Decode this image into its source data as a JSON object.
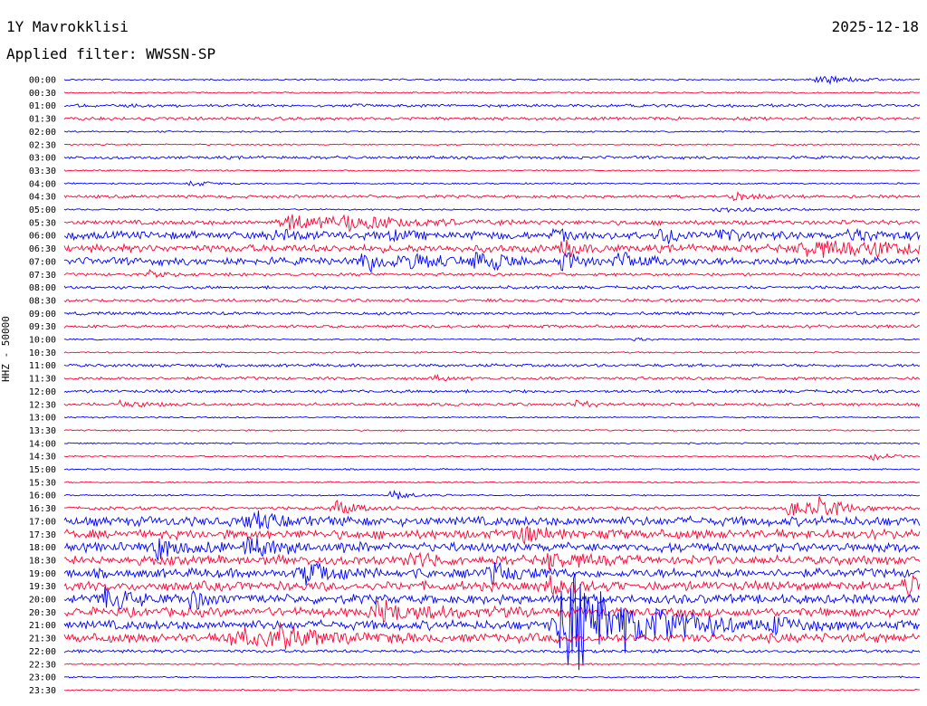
{
  "header": {
    "station": "1Y Mavrokklisi",
    "filter": "Applied filter: WWSSN-SP",
    "date": "2025-12-18"
  },
  "channel_label": "HHZ - 50000",
  "chart_data": {
    "type": "line",
    "title": "1Y Mavrokklisi",
    "subtitle": "Applied filter: WWSSN-SP",
    "ylabel": "HHZ - 50000",
    "grid": false,
    "colors": {
      "blue": "#0000ff",
      "red": "#ff0033"
    },
    "rows": [
      "00:00",
      "00:30",
      "01:00",
      "01:30",
      "02:00",
      "02:30",
      "03:00",
      "03:30",
      "04:00",
      "04:30",
      "05:00",
      "05:30",
      "06:00",
      "06:30",
      "07:00",
      "07:30",
      "08:00",
      "08:30",
      "09:00",
      "09:30",
      "10:00",
      "10:30",
      "11:00",
      "11:30",
      "12:00",
      "12:30",
      "13:00",
      "13:30",
      "14:00",
      "14:30",
      "15:00",
      "15:30",
      "16:00",
      "16:30",
      "17:00",
      "17:30",
      "18:00",
      "18:30",
      "19:00",
      "19:30",
      "20:00",
      "20:30",
      "21:00",
      "21:30",
      "22:00",
      "22:30",
      "23:00",
      "23:30"
    ],
    "noise_level": [
      1,
      1,
      2,
      2,
      1,
      1,
      2,
      1,
      1,
      2,
      1,
      3,
      5,
      5,
      5,
      2,
      2,
      2,
      2,
      2,
      1,
      1,
      2,
      2,
      2,
      2,
      1,
      1,
      1,
      1,
      1,
      1,
      1,
      2,
      6,
      6,
      6,
      6,
      6,
      6,
      6,
      6,
      6,
      6,
      2,
      1,
      1,
      1
    ],
    "events": [
      {
        "row": "00:00",
        "minute": 26.5,
        "amp": 6,
        "dur": 1.5
      },
      {
        "row": "04:00",
        "minute": 4.5,
        "amp": 3,
        "dur": 1.0
      },
      {
        "row": "04:30",
        "minute": 23.5,
        "amp": 4,
        "dur": 1.2
      },
      {
        "row": "05:00",
        "minute": 23.0,
        "amp": 3,
        "dur": 2.0
      },
      {
        "row": "05:30",
        "minute": 8.0,
        "amp": 10,
        "dur": 2.5
      },
      {
        "row": "05:30",
        "minute": 10.0,
        "amp": 7,
        "dur": 2.5
      },
      {
        "row": "06:00",
        "minute": 7.5,
        "amp": 8,
        "dur": 1.0
      },
      {
        "row": "06:00",
        "minute": 11.5,
        "amp": 7,
        "dur": 0.5
      },
      {
        "row": "06:00",
        "minute": 17.2,
        "amp": 7,
        "dur": 0.5
      },
      {
        "row": "06:00",
        "minute": 21.0,
        "amp": 10,
        "dur": 0.8
      },
      {
        "row": "06:00",
        "minute": 23.0,
        "amp": 9,
        "dur": 0.8
      },
      {
        "row": "06:00",
        "minute": 27.6,
        "amp": 8,
        "dur": 1.0
      },
      {
        "row": "06:30",
        "minute": 17.5,
        "amp": 9,
        "dur": 0.8
      },
      {
        "row": "06:30",
        "minute": 26.0,
        "amp": 9,
        "dur": 2.5
      },
      {
        "row": "06:30",
        "minute": 28.5,
        "amp": 8,
        "dur": 1.2
      },
      {
        "row": "07:00",
        "minute": 10.5,
        "amp": 12,
        "dur": 1.2
      },
      {
        "row": "07:00",
        "minute": 12.3,
        "amp": 10,
        "dur": 1.0
      },
      {
        "row": "07:00",
        "minute": 14.5,
        "amp": 12,
        "dur": 1.2
      },
      {
        "row": "07:00",
        "minute": 17.5,
        "amp": 10,
        "dur": 1.0
      },
      {
        "row": "07:00",
        "minute": 19.5,
        "amp": 10,
        "dur": 1.0
      },
      {
        "row": "07:30",
        "minute": 3.0,
        "amp": 4,
        "dur": 1.0
      },
      {
        "row": "10:00",
        "minute": 20.0,
        "amp": 3,
        "dur": 0.5
      },
      {
        "row": "11:30",
        "minute": 13.0,
        "amp": 3,
        "dur": 0.6
      },
      {
        "row": "12:30",
        "minute": 2.0,
        "amp": 6,
        "dur": 0.8
      },
      {
        "row": "12:30",
        "minute": 18.0,
        "amp": 6,
        "dur": 0.6
      },
      {
        "row": "14:30",
        "minute": 28.3,
        "amp": 4,
        "dur": 1.0
      },
      {
        "row": "16:00",
        "minute": 11.5,
        "amp": 7,
        "dur": 0.8
      },
      {
        "row": "16:30",
        "minute": 9.5,
        "amp": 12,
        "dur": 0.8
      },
      {
        "row": "16:30",
        "minute": 25.5,
        "amp": 11,
        "dur": 1.2
      },
      {
        "row": "16:30",
        "minute": 26.5,
        "amp": 10,
        "dur": 1.2
      },
      {
        "row": "17:00",
        "minute": 6.5,
        "amp": 9,
        "dur": 1.2
      },
      {
        "row": "17:30",
        "minute": 16.0,
        "amp": 12,
        "dur": 1.0
      },
      {
        "row": "18:00",
        "minute": 3.3,
        "amp": 12,
        "dur": 1.2
      },
      {
        "row": "18:00",
        "minute": 6.5,
        "amp": 12,
        "dur": 1.5
      },
      {
        "row": "18:30",
        "minute": 12.0,
        "amp": 12,
        "dur": 0.8
      },
      {
        "row": "18:30",
        "minute": 17.0,
        "amp": 12,
        "dur": 1.0
      },
      {
        "row": "19:00",
        "minute": 8.5,
        "amp": 12,
        "dur": 1.5
      },
      {
        "row": "19:00",
        "minute": 15.0,
        "amp": 12,
        "dur": 1.0
      },
      {
        "row": "19:30",
        "minute": 17.0,
        "amp": 12,
        "dur": 1.0
      },
      {
        "row": "19:30",
        "minute": 29.5,
        "amp": 12,
        "dur": 0.8
      },
      {
        "row": "20:00",
        "minute": 1.5,
        "amp": 12,
        "dur": 1.2
      },
      {
        "row": "20:00",
        "minute": 4.5,
        "amp": 10,
        "dur": 0.8
      },
      {
        "row": "20:30",
        "minute": 11.0,
        "amp": 12,
        "dur": 2.0
      },
      {
        "row": "21:00",
        "minute": 17.7,
        "amp": 70,
        "dur": 2.5
      },
      {
        "row": "21:00",
        "minute": 21.0,
        "amp": 10,
        "dur": 1.5
      },
      {
        "row": "21:00",
        "minute": 25.0,
        "amp": 9,
        "dur": 1.2
      },
      {
        "row": "21:30",
        "minute": 6.0,
        "amp": 12,
        "dur": 1.5
      },
      {
        "row": "21:30",
        "minute": 7.5,
        "amp": 14,
        "dur": 1.5
      }
    ]
  }
}
